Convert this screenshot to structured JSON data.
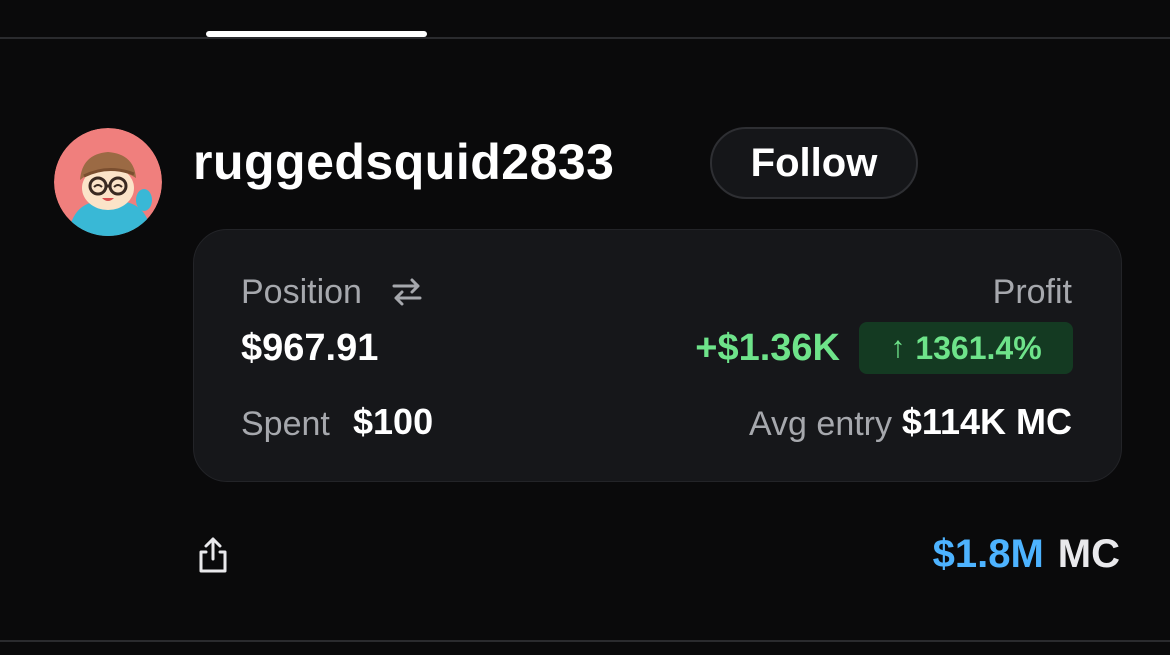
{
  "user": {
    "username": "ruggedsquid2833",
    "follow_label": "Follow"
  },
  "position_card": {
    "position_label": "Position",
    "position_value": "$967.91",
    "spent_label": "Spent",
    "spent_value": "$100",
    "profit_label": "Profit",
    "profit_value": "+$1.36K",
    "profit_percent": "1361.4%",
    "avg_entry_label": "Avg entry",
    "avg_entry_value": "$114K MC"
  },
  "footer": {
    "market_cap_value": "$1.8M",
    "market_cap_unit": "MC"
  },
  "icons": {
    "swap": "swap-arrows-icon",
    "share": "share-icon",
    "up_arrow": "arrow-up-icon"
  },
  "colors": {
    "background": "#0a0a0b",
    "card": "#16171a",
    "positive": "#6ee38a",
    "positive_badge": "#143a22",
    "accent_blue": "#4db3ff"
  }
}
